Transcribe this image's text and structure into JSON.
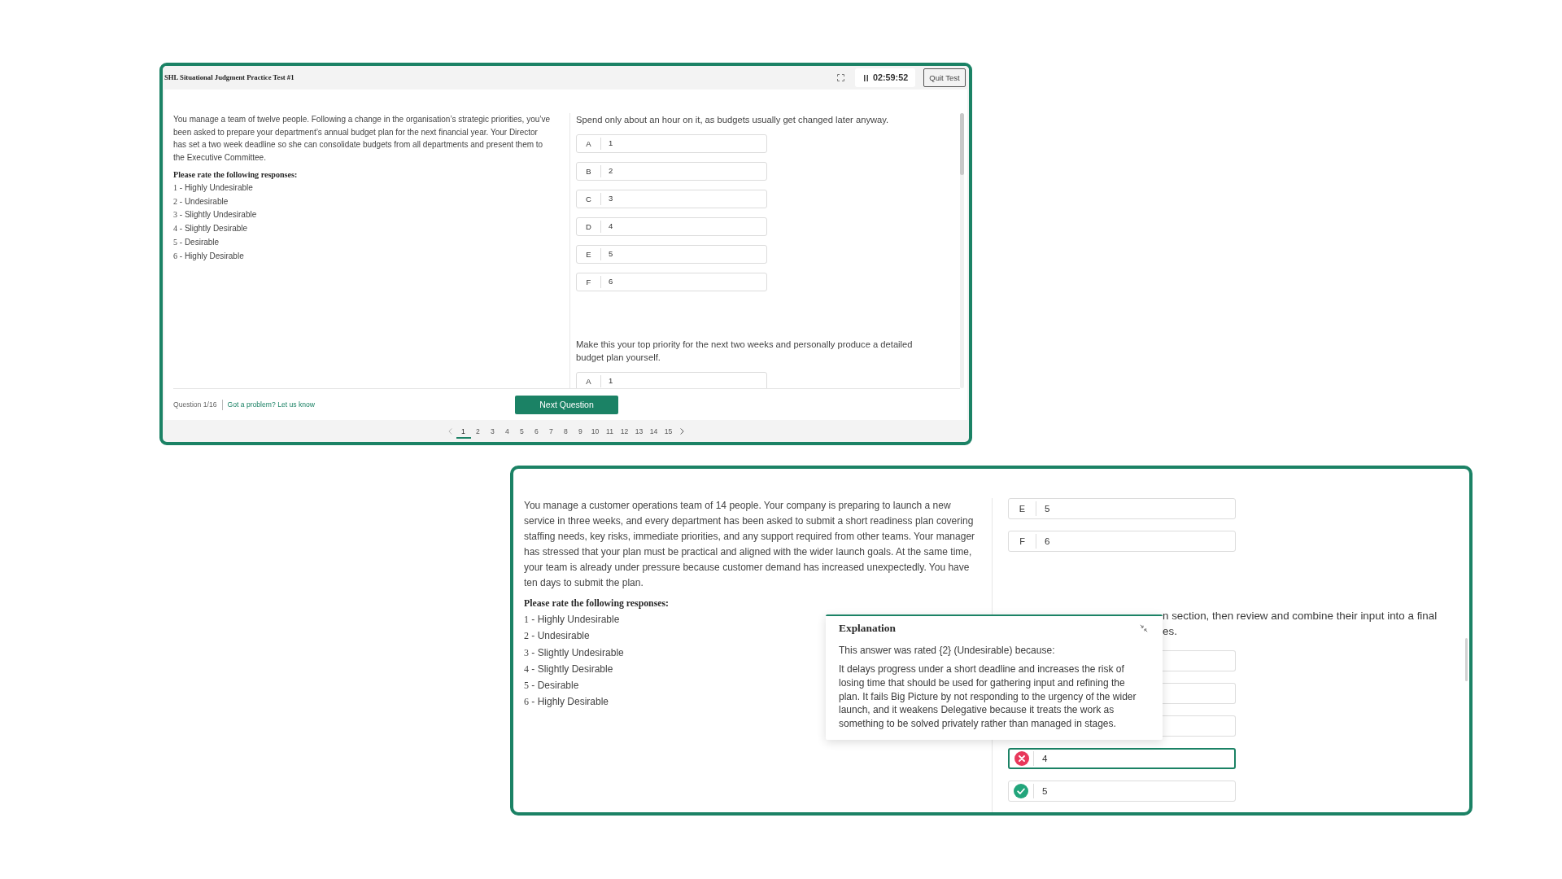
{
  "test_window": {
    "title": "SHL Situational Judgment Practice Test #1",
    "timer": "02:59:52",
    "quit_button": "Quit Test",
    "scenario": {
      "text": "You manage a team of twelve people. Following a change in the organisation’s strategic priorities, you’ve been asked to prepare your department’s annual budget plan for the next financial year. Your Director has set a two week deadline so she can consolidate budgets from all departments and present them to the Executive Committee.",
      "rating_heading": "Please rate the following responses:",
      "rating_scale": [
        "1 - Highly Undesirable",
        "2 - Undesirable",
        "3 - Slightly Undesirable",
        "4 - Slightly Desirable",
        "5 - Desirable",
        "6 - Highly Desirable"
      ]
    },
    "responses": [
      {
        "statement": "Spend only about an hour on it, as budgets usually get changed later anyway.",
        "options": [
          {
            "kind": "lettered",
            "letter": "A",
            "value": "1",
            "selected": false
          },
          {
            "kind": "lettered",
            "letter": "B",
            "value": "2",
            "selected": false
          },
          {
            "kind": "lettered",
            "letter": "C",
            "value": "3",
            "selected": false
          },
          {
            "kind": "lettered",
            "letter": "D",
            "value": "4",
            "selected": false
          },
          {
            "kind": "lettered",
            "letter": "E",
            "value": "5",
            "selected": false
          },
          {
            "kind": "lettered",
            "letter": "F",
            "value": "6",
            "selected": false
          }
        ]
      },
      {
        "statement": "Make this your top priority for the next two weeks and personally produce a detailed budget plan yourself.",
        "options": [
          {
            "kind": "lettered",
            "letter": "A",
            "value": "1",
            "selected": false
          }
        ]
      }
    ],
    "footer": {
      "question_counter": "Question 1/16",
      "report_link": "Got a problem? Let us know",
      "next_button": "Next Question"
    },
    "pagination": {
      "previous_disabled": true,
      "next_disabled": false,
      "pages": [
        {
          "label": "1",
          "selected": true
        },
        {
          "label": "2",
          "selected": false
        },
        {
          "label": "3",
          "selected": false
        },
        {
          "label": "4",
          "selected": false
        },
        {
          "label": "5",
          "selected": false
        },
        {
          "label": "6",
          "selected": false
        },
        {
          "label": "7",
          "selected": false
        },
        {
          "label": "8",
          "selected": false
        },
        {
          "label": "9",
          "selected": false
        },
        {
          "label": "10",
          "selected": false
        },
        {
          "label": "11",
          "selected": false
        },
        {
          "label": "12",
          "selected": false
        },
        {
          "label": "13",
          "selected": false
        },
        {
          "label": "14",
          "selected": false
        },
        {
          "label": "15",
          "selected": false
        }
      ]
    }
  },
  "review_window": {
    "scenario": {
      "text": "You manage a customer operations team of 14 people. Your company is preparing to launch a new service in three weeks, and every department has been asked to submit a short readiness plan covering staffing needs, key risks, immediate priorities, and any support required from other teams. Your manager has stressed that your plan must be practical and aligned with the wider launch goals. At the same time, your team is already under pressure because customer demand has increased unexpectedly. You have ten days to submit the plan.",
      "rating_heading": "Please rate the following responses:",
      "rating_scale": [
        "1 - Highly Undesirable",
        "2 - Undesirable",
        "3 - Slightly Undesirable",
        "4 - Slightly Desirable",
        "5 - Desirable",
        "6 - Highly Desirable"
      ]
    },
    "responses": [
      {
        "options": [
          {
            "kind": "lettered",
            "letter": "E",
            "value": "5",
            "selected": false
          },
          {
            "kind": "lettered",
            "letter": "F",
            "value": "6",
            "selected": false
          }
        ]
      },
      {
        "statement_visible_lines": [
          "n section, then review and combine their input into a final",
          "es."
        ],
        "options": [
          {
            "kind": "covered",
            "selected": false
          },
          {
            "kind": "covered",
            "selected": false
          },
          {
            "kind": "covered",
            "selected": false
          },
          {
            "kind": "marked",
            "correct": false,
            "value": "4",
            "selected": true
          },
          {
            "kind": "marked",
            "correct": true,
            "value": "5",
            "selected": false
          }
        ]
      }
    ],
    "explanation": {
      "title": "Explanation",
      "summary": "This answer was rated {2} (Undesirable) because:",
      "text": "It delays progress under a short deadline and increases the risk of losing time that should be used for gathering input and refining the plan. It fails Big Picture by not responding to the urgency of the wider launch, and it weakens Delegative because it treats the work as something to be solved privately rather than managed in stages."
    }
  }
}
